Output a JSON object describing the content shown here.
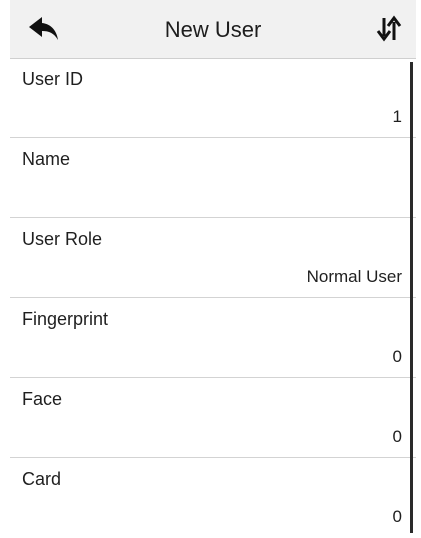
{
  "header": {
    "title": "New User",
    "back_icon": "back-arrow-icon",
    "sort_icon": "sort-arrows-icon"
  },
  "fields": [
    {
      "label": "User ID",
      "value": "1"
    },
    {
      "label": "Name",
      "value": ""
    },
    {
      "label": "User Role",
      "value": "Normal User"
    },
    {
      "label": "Fingerprint",
      "value": "0"
    },
    {
      "label": "Face",
      "value": "0"
    },
    {
      "label": "Card",
      "value": "0"
    }
  ],
  "colors": {
    "header_bg": "#f1f1f1",
    "divider": "#d3d3d3",
    "text": "#1f1f1f",
    "scrollbar": "#2a2a2a"
  }
}
